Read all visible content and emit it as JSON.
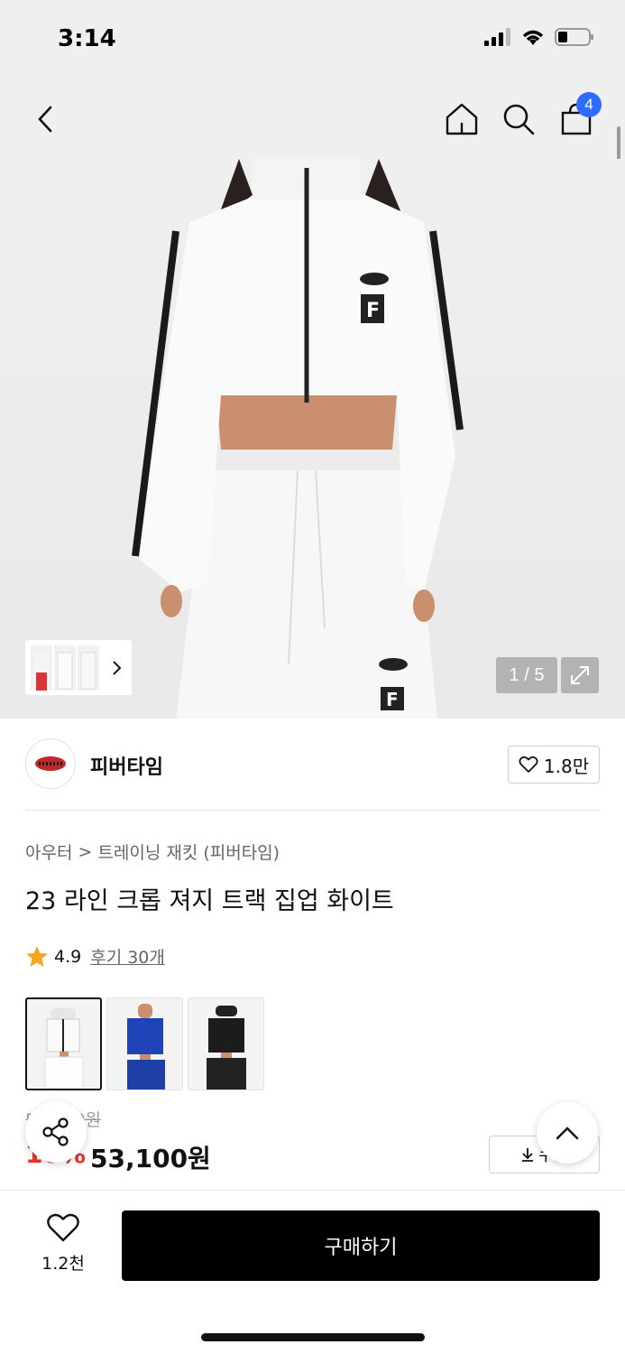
{
  "status": {
    "time": "3:14"
  },
  "nav": {
    "cart_count": "4"
  },
  "gallery": {
    "counter": "1 / 5"
  },
  "brand": {
    "name": "피버타임",
    "likes": "1.8만"
  },
  "breadcrumb": {
    "category": "아우터",
    "separator": ">",
    "subcategory": "트레이닝 재킷 (피버타임)"
  },
  "product": {
    "title": "23 라인 크롭 져지 트랙 집업 화이트",
    "rating": "4.9",
    "reviews": "후기 30개",
    "colors": [
      "white",
      "blue",
      "black"
    ],
    "original_price": "59,000원",
    "discount": "10%",
    "price": "53,100원",
    "coupon_label": "쿠폰"
  },
  "bottom": {
    "wish_count": "1.2천",
    "buy_label": "구매하기"
  },
  "colors": {
    "accent_blue": "#2f6bff",
    "star": "#f5a623",
    "discount_red": "#e8332a"
  }
}
